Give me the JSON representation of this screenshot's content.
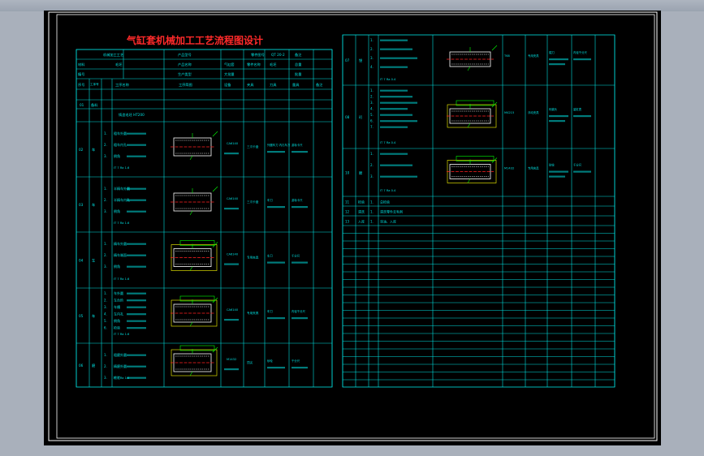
{
  "drawing": {
    "title": "气缸套机械加工工艺流程图设计",
    "colors": {
      "background": "#000000",
      "border": "#ffffff",
      "table_lines": "#00e0e0",
      "title_text": "#ff2a2a",
      "part_outline": "#ffffff",
      "centerline": "#ff2020",
      "dimension": "#00ff00",
      "fixture": "#ffff00",
      "outer_bg": "#a9b0bb"
    },
    "left_table": {
      "header_row1": [
        "机械加工工艺",
        "",
        "产品型号",
        "",
        "零件图号",
        "QT 20-2",
        "备注"
      ],
      "header_row2": [
        "材料",
        "",
        "毛坯",
        "",
        "产品名称",
        "",
        "气缸套",
        "零件名称",
        "毛坯",
        "总重"
      ],
      "header_row3": [
        "编号",
        "",
        "生产类型",
        "",
        "大批量",
        "批量"
      ],
      "columns": [
        "序号",
        "工序号",
        "工序名称",
        "工序简图",
        "设备",
        "夹具",
        "刀具",
        "量具",
        "备注"
      ],
      "op_rows": [
        {
          "no": "01",
          "name": "备料",
          "content": "铸造毛坯 HT200"
        },
        {
          "no": "02",
          "name": "车",
          "steps": [
            "1.",
            "2.",
            "3."
          ],
          "content": [
            "粗车外圆",
            "粗车内孔",
            "倒角"
          ],
          "equipment": "CA6140",
          "fixture": "三爪卡盘",
          "tool": "外圆车刀 内孔车刀",
          "gauge": "游标卡尺"
        },
        {
          "no": "03",
          "name": "车",
          "steps": [
            "1.",
            "2.",
            "3."
          ],
          "content": [
            "半精车外圆",
            "半精车内孔",
            "倒角"
          ],
          "equipment": "CA6140",
          "fixture": "三爪卡盘",
          "tool": "车刀",
          "gauge": "游标卡尺"
        },
        {
          "no": "04",
          "name": "车",
          "steps": [
            "1.",
            "2.",
            "3."
          ],
          "content": [
            "精车外圆",
            "精车端面",
            "倒角"
          ],
          "equipment": "CA6140",
          "fixture": "专用夹具",
          "tool": "车刀",
          "gauge": "千分尺"
        },
        {
          "no": "05",
          "name": "车",
          "steps": [
            "1.",
            "2.",
            "3.",
            "4.",
            "5.",
            "6."
          ],
          "content": [
            "车外圆",
            "车台阶",
            "车槽",
            "车内孔",
            "倒角",
            "检验"
          ],
          "equipment": "CA6140",
          "fixture": "专用夹具",
          "tool": "车刀",
          "gauge": "内径千分尺"
        },
        {
          "no": "06",
          "name": "磨",
          "steps": [
            "1.",
            "2.",
            "3."
          ],
          "content": [
            "粗磨外圆",
            "精磨外圆",
            "检验"
          ],
          "equipment": "M1432",
          "fixture": "顶尖",
          "tool": "砂轮",
          "gauge": "千分尺"
        }
      ]
    },
    "right_table": {
      "op_rows": [
        {
          "no": "07",
          "name": "镗",
          "steps": [
            "1.",
            "2.",
            "3.",
            "4."
          ],
          "equipment": "T68",
          "fixture": "专用夹具",
          "tool": "镗刀",
          "gauge": "内径千分尺"
        },
        {
          "no": "08",
          "name": "珩",
          "steps": [
            "1.",
            "2.",
            "3.",
            "4.",
            "5.",
            "6.",
            "7."
          ],
          "equipment": "M4215",
          "fixture": "浮动夹具",
          "tool": "珩磨头",
          "gauge": "量缸表"
        },
        {
          "no": "10",
          "name": "磨",
          "steps": [
            "1.",
            "2.",
            "3."
          ],
          "equipment": "M1432",
          "fixture": "专用夹具",
          "tool": "砂轮",
          "gauge": "千分尺"
        }
      ],
      "simple_rows": [
        {
          "no": "11",
          "name": "检验",
          "step": "1.",
          "content": "总检验"
        },
        {
          "no": "12",
          "name": "清洗",
          "step": "1.",
          "content": "清洗零件去毛刺"
        },
        {
          "no": "13",
          "name": "入库",
          "step": "1.",
          "content": "涂油、入库"
        }
      ]
    }
  }
}
